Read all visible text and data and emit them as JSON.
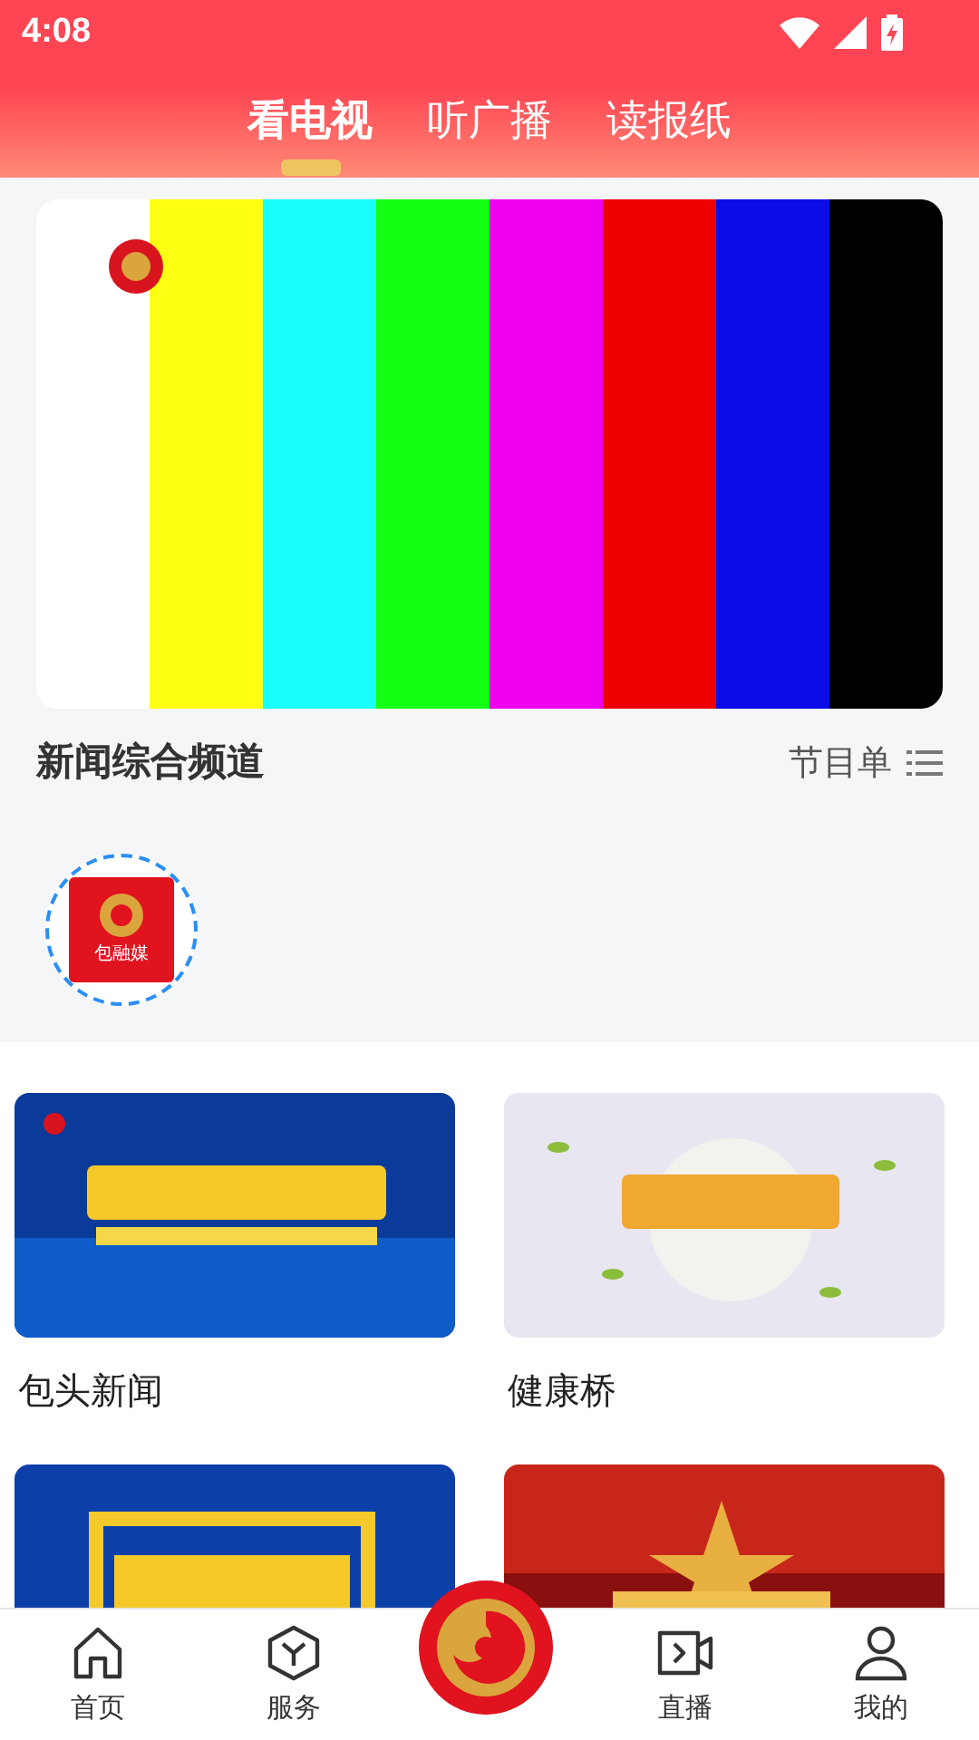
{
  "status_bar": {
    "time": "4:08"
  },
  "tabs": [
    {
      "label": "看电视",
      "selected": true
    },
    {
      "label": "听广播",
      "selected": false
    },
    {
      "label": "读报纸",
      "selected": false
    }
  ],
  "player": {
    "kind": "picture"
  },
  "channel": {
    "title": "新闻综合频道",
    "schedule_link": "节目单"
  },
  "channel_logos": [
    {
      "text": "包融媒",
      "selected": true
    }
  ],
  "programs": [
    {
      "kind": "picture",
      "title": "包头新闻"
    },
    {
      "kind": "picture",
      "title": "健康桥"
    },
    {
      "kind": "picture"
    },
    {
      "kind": "picture"
    }
  ],
  "bottom_nav": [
    {
      "kind": "home",
      "label": "首页"
    },
    {
      "kind": "service",
      "label": "服务"
    },
    {
      "kind": "logo"
    },
    {
      "kind": "live",
      "label": "直播"
    },
    {
      "kind": "mine",
      "label": "我的"
    }
  ]
}
